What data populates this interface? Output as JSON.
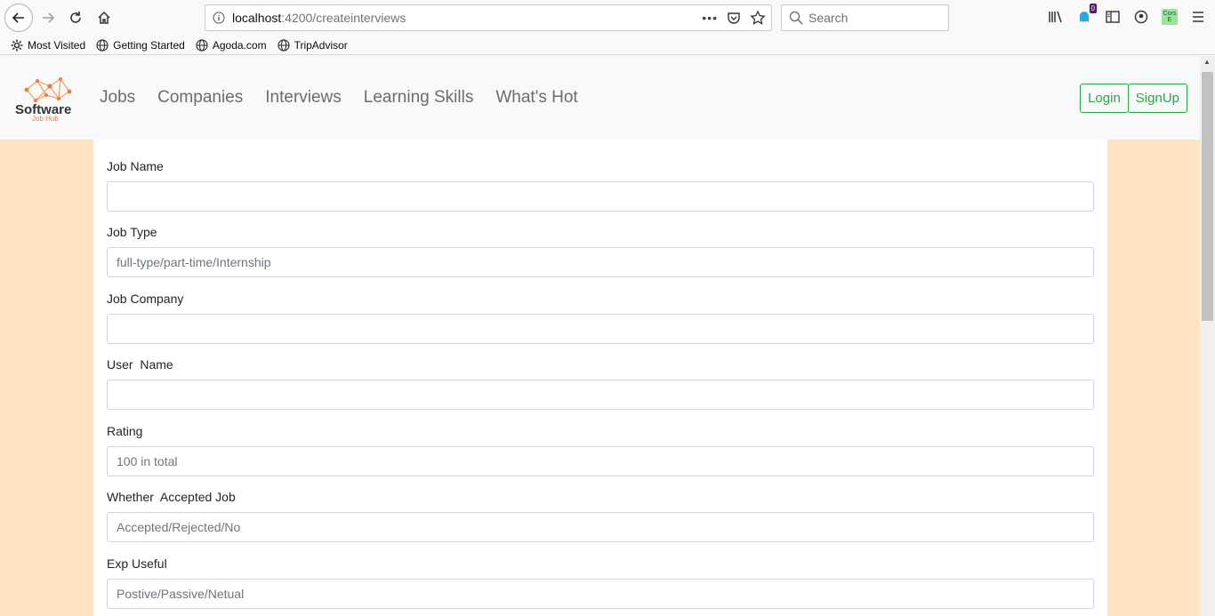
{
  "browser": {
    "url_host": "localhost",
    "url_path": ":4200/createinterviews",
    "search_placeholder": "Search",
    "badge_count": "0",
    "cors_label_top": "Cors",
    "cors_label_bottom": "E",
    "bookmarks": [
      {
        "label": "Most Visited",
        "icon": "gear-icon"
      },
      {
        "label": "Getting Started",
        "icon": "globe-icon"
      },
      {
        "label": "Agoda.com",
        "icon": "globe-icon"
      },
      {
        "label": "TripAdvisor",
        "icon": "globe-icon"
      }
    ]
  },
  "navbar": {
    "logo_text": "Software",
    "logo_sub": "Job Hub",
    "links": [
      "Jobs",
      "Companies",
      "Interviews",
      "Learning Skills",
      "What's Hot"
    ],
    "login_label": "Login",
    "signup_label": "SignUp",
    "accent_color": "#28a745"
  },
  "form": {
    "fields": [
      {
        "label": "Job Name",
        "placeholder": ""
      },
      {
        "label": "Job Type",
        "placeholder": "full-type/part-time/Internship"
      },
      {
        "label": "Job Company",
        "placeholder": ""
      },
      {
        "label": "User  Name",
        "placeholder": ""
      },
      {
        "label": "Rating",
        "placeholder": "100 in total"
      },
      {
        "label": "Whether  Accepted Job",
        "placeholder": "Accepted/Rejected/No"
      },
      {
        "label": "Exp Useful",
        "placeholder": "Postive/Passive/Netual"
      }
    ]
  },
  "page_background": "#ffe4c2"
}
